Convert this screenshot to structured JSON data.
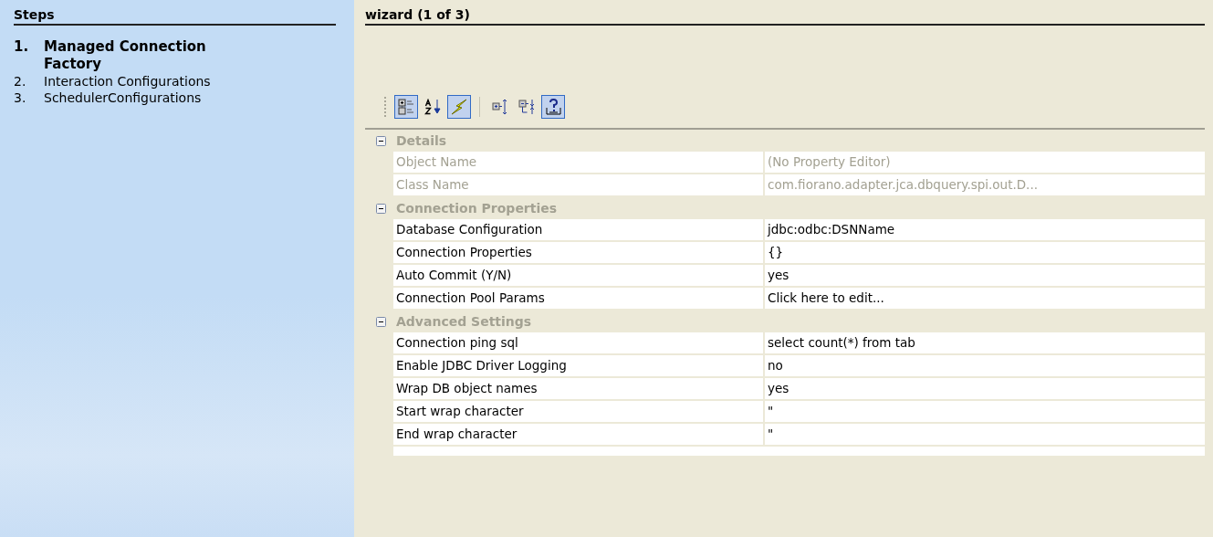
{
  "steps_panel": {
    "title": "Steps",
    "steps": [
      {
        "number": "1.",
        "label": "Managed Connection Factory",
        "selected": true
      },
      {
        "number": "2.",
        "label": "Interaction Configurations",
        "selected": false
      },
      {
        "number": "3.",
        "label": "SchedulerConfigurations",
        "selected": false
      }
    ]
  },
  "wizard": {
    "title": "wizard (1 of 3)",
    "toolbar": [
      {
        "kind": "categorized",
        "on": true
      },
      {
        "kind": "alphabetical",
        "on": false
      },
      {
        "kind": "events",
        "on": true
      },
      {
        "kind": "separator"
      },
      {
        "kind": "expand-all",
        "on": false
      },
      {
        "kind": "collapse-all",
        "on": false
      },
      {
        "kind": "help",
        "on": true
      }
    ],
    "categories": [
      {
        "title": "Details",
        "expanded": true,
        "properties": [
          {
            "name": "Object Name",
            "value": "(No Property Editor)",
            "disabled": true
          },
          {
            "name": "Class Name",
            "value": "com.fiorano.adapter.jca.dbquery.spi.out.D...",
            "disabled": true
          }
        ]
      },
      {
        "title": "Connection Properties",
        "expanded": true,
        "properties": [
          {
            "name": "Database Configuration",
            "value": "jdbc:odbc:DSNName",
            "disabled": false
          },
          {
            "name": "Connection Properties",
            "value": "{}",
            "disabled": false
          },
          {
            "name": "Auto Commit (Y/N)",
            "value": "yes",
            "disabled": false
          },
          {
            "name": "Connection Pool Params",
            "value": "Click here to edit...",
            "disabled": false
          }
        ]
      },
      {
        "title": "Advanced Settings",
        "expanded": true,
        "properties": [
          {
            "name": "Connection ping sql",
            "value": "select count(*) from tab",
            "disabled": false
          },
          {
            "name": "Enable JDBC Driver Logging",
            "value": "no",
            "disabled": false
          },
          {
            "name": "Wrap DB object names",
            "value": "yes",
            "disabled": false
          },
          {
            "name": "Start wrap character",
            "value": "\"",
            "disabled": false
          },
          {
            "name": "End wrap character",
            "value": "\"",
            "disabled": false
          }
        ]
      }
    ]
  }
}
